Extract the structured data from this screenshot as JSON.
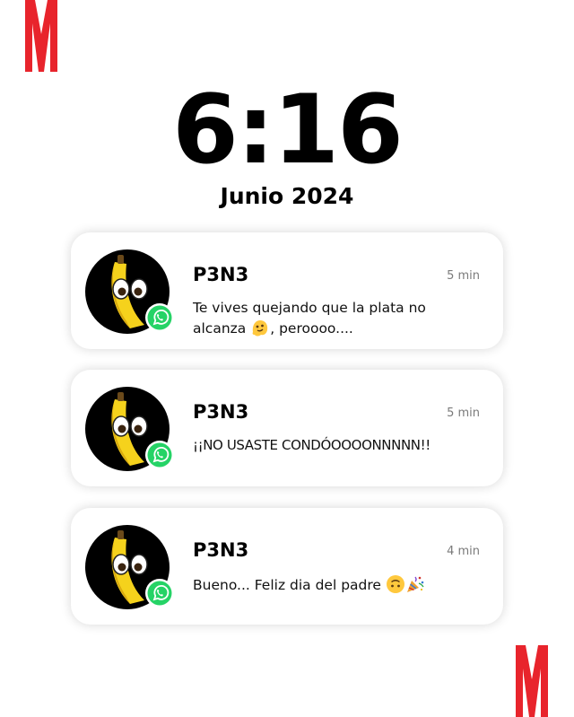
{
  "lockscreen": {
    "time": "6:16",
    "date": "Junio 2024"
  },
  "brand": {
    "logo": "M",
    "color": "#e8242c"
  },
  "notifications": [
    {
      "app_icon": "whatsapp-icon",
      "sender": "P3N3",
      "time_ago": "5 min",
      "message_part1": "Te vives quejando que la plata no alcanza ",
      "emoji1": "melting-face-emoji",
      "message_part2": ", peroooo....",
      "emoji2": ""
    },
    {
      "app_icon": "whatsapp-icon",
      "sender": "P3N3",
      "time_ago": "5 min",
      "message_part1": "¡¡NO USASTE CONDÓOOOONNNNN!!",
      "emoji1": "",
      "message_part2": "",
      "emoji2": ""
    },
    {
      "app_icon": "whatsapp-icon",
      "sender": "P3N3",
      "time_ago": "4 min",
      "message_part1": "Bueno... Feliz dia del padre ",
      "emoji1": "upside-down-face-emoji",
      "message_part2": "",
      "emoji2": "party-popper-emoji"
    }
  ],
  "colors": {
    "whatsapp_green": "#25d366",
    "avatar_bg": "#000000",
    "banana": "#f5d21c"
  }
}
